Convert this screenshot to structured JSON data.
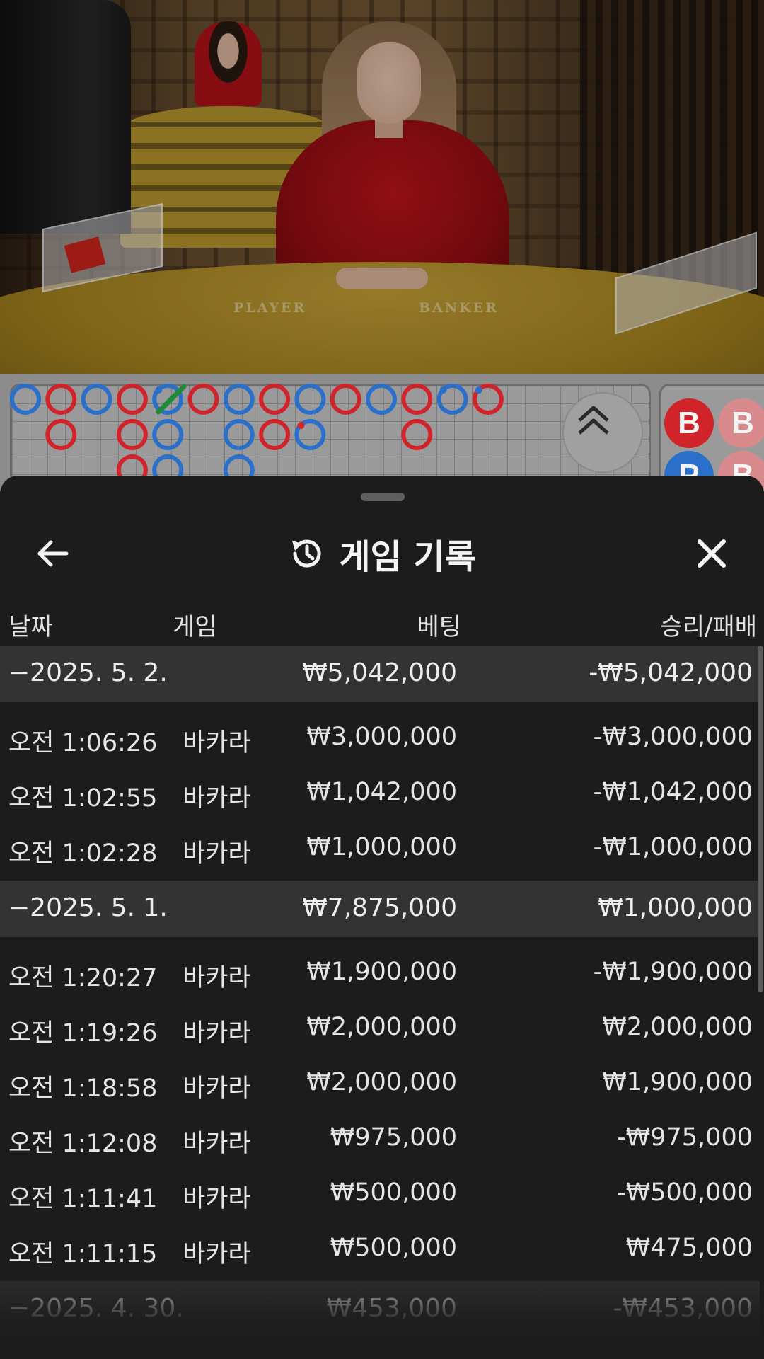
{
  "video": {
    "table_labels": {
      "player": "PLAYER",
      "banker": "BANKER"
    }
  },
  "roadmap": {
    "bead_colors": {
      "banker": "#d0232a",
      "player": "#2a6fc9",
      "tie": "#1f8a3a"
    },
    "side_chips": [
      {
        "label": "B",
        "color": "#d0232a"
      },
      {
        "label": "B",
        "color": "#d88a8c"
      },
      {
        "label": "P",
        "color": "#2a6fc9"
      },
      {
        "label": "B",
        "color": "#d88a8c"
      }
    ]
  },
  "sheet": {
    "title": "게임 기록",
    "icons": {
      "back": "arrow-left-icon",
      "history": "history-icon",
      "close": "close-icon",
      "scroll_up": "chevron-double-up-icon"
    },
    "columns": {
      "date": "날짜",
      "game": "게임",
      "bet": "베팅",
      "result": "승리/패배"
    },
    "groups": [
      {
        "date": "−2025. 5. 2.",
        "bet": "₩5,042,000",
        "result": "-₩5,042,000",
        "rows": [
          {
            "time": "오전 1:06:26",
            "game": "바카라",
            "bet": "₩3,000,000",
            "result": "-₩3,000,000"
          },
          {
            "time": "오전 1:02:55",
            "game": "바카라",
            "bet": "₩1,042,000",
            "result": "-₩1,042,000"
          },
          {
            "time": "오전 1:02:28",
            "game": "바카라",
            "bet": "₩1,000,000",
            "result": "-₩1,000,000"
          }
        ]
      },
      {
        "date": "−2025. 5. 1.",
        "bet": "₩7,875,000",
        "result": "₩1,000,000",
        "rows": [
          {
            "time": "오전 1:20:27",
            "game": "바카라",
            "bet": "₩1,900,000",
            "result": "-₩1,900,000"
          },
          {
            "time": "오전 1:19:26",
            "game": "바카라",
            "bet": "₩2,000,000",
            "result": "₩2,000,000"
          },
          {
            "time": "오전 1:18:58",
            "game": "바카라",
            "bet": "₩2,000,000",
            "result": "₩1,900,000"
          },
          {
            "time": "오전 1:12:08",
            "game": "바카라",
            "bet": "₩975,000",
            "result": "-₩975,000"
          },
          {
            "time": "오전 1:11:41",
            "game": "바카라",
            "bet": "₩500,000",
            "result": "-₩500,000"
          },
          {
            "time": "오전 1:11:15",
            "game": "바카라",
            "bet": "₩500,000",
            "result": "₩475,000"
          }
        ]
      },
      {
        "date": "−2025. 4. 30.",
        "bet": "₩453,000",
        "result": "-₩453,000",
        "rows": []
      }
    ]
  }
}
